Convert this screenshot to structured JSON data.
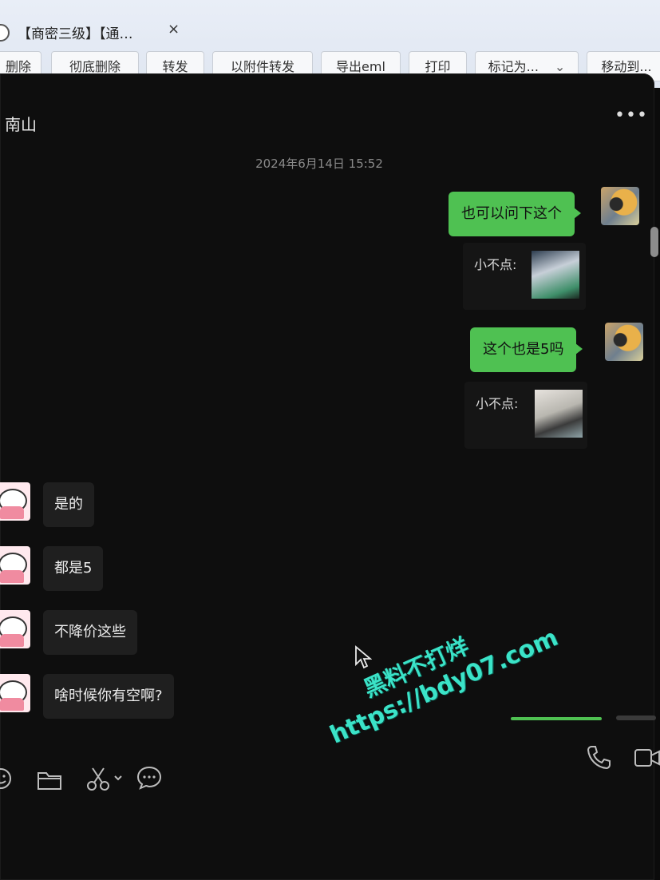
{
  "tab": {
    "title": "【商密三级】【通…",
    "close_label": "×"
  },
  "toolbar": {
    "buttons": [
      "删除",
      "彻底删除",
      "转发",
      "以附件转发",
      "导出eml",
      "打印",
      "标记为...",
      "移动到..."
    ]
  },
  "chat": {
    "contact_name": "南山",
    "more_label": "•••",
    "timestamp": "2024年6月14日 15:52",
    "messages": [
      {
        "direction": "out",
        "text": "也可以问下这个"
      },
      {
        "direction": "quote",
        "label": "小不点:"
      },
      {
        "direction": "out",
        "text": "这个也是5吗"
      },
      {
        "direction": "quote",
        "label": "小不点:"
      },
      {
        "direction": "in",
        "text": "是的"
      },
      {
        "direction": "in",
        "text": "都是5"
      },
      {
        "direction": "in",
        "text": "不降价这些"
      },
      {
        "direction": "in",
        "text": "啥时候你有空啊?"
      }
    ]
  },
  "bottom_bar": {
    "icons": [
      "emoji-icon",
      "folder-icon",
      "scissors-icon",
      "chat-bubble-icon",
      "phone-icon",
      "video-icon"
    ]
  },
  "watermark": {
    "line1": "黑料不打烊",
    "line2": "https://bdy07.com"
  },
  "colors": {
    "accent_green": "#4fc152",
    "watermark_teal": "#3be3c8"
  }
}
